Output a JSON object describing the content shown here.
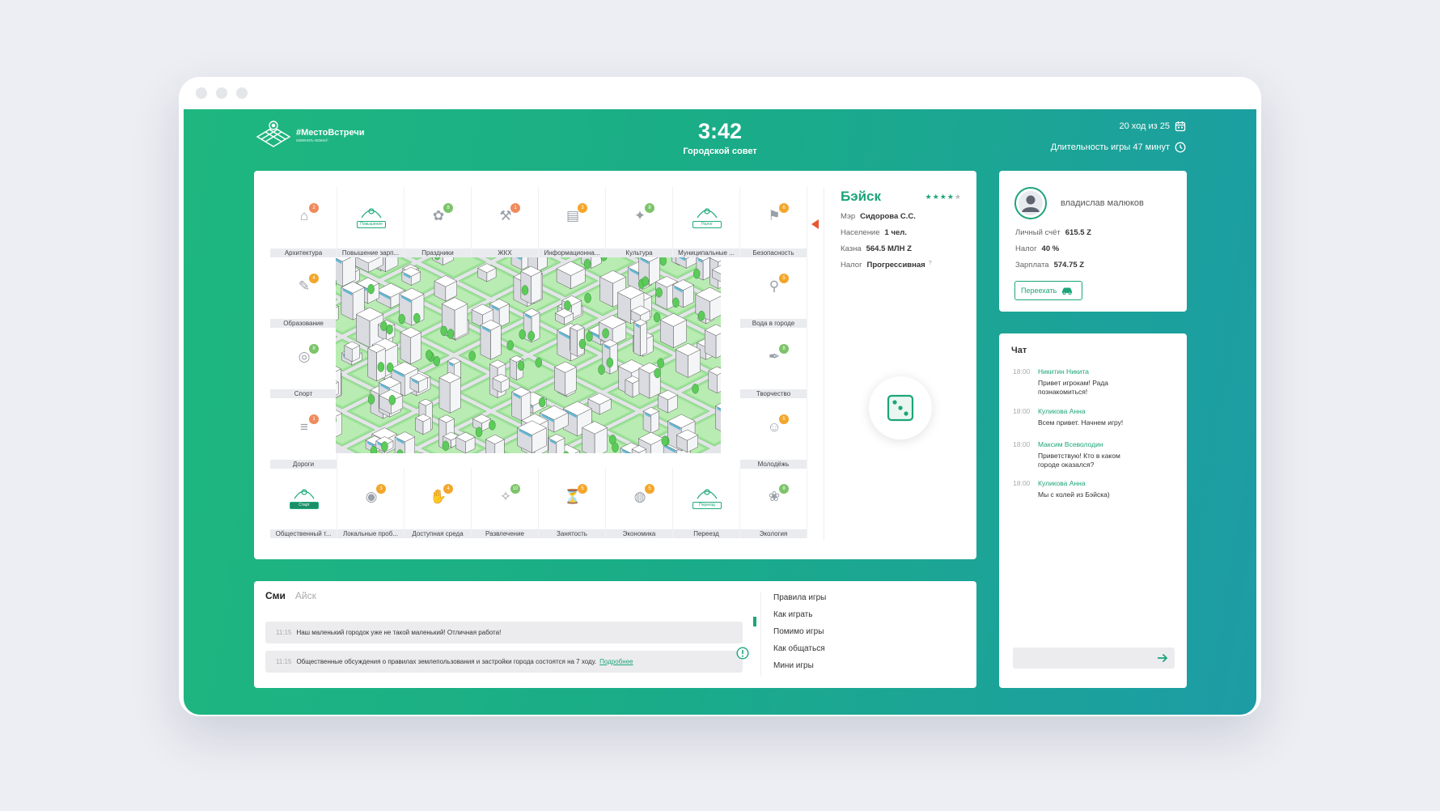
{
  "header": {
    "logo_title": "#МестоВстречи",
    "logo_subtitle": "изменить можно!",
    "timer": "3:42",
    "screen": "Городской совет",
    "turn": "20 ход из 25",
    "duration": "Длительность игры 47 минут"
  },
  "board": {
    "tiles": [
      {
        "label": "Архитектура",
        "badge": "2",
        "badge_color": "#f08a5d"
      },
      {
        "label": "Повышение зарп...",
        "plate": "Повышение"
      },
      {
        "label": "Праздники",
        "badge": "8",
        "badge_color": "#7cc46a"
      },
      {
        "label": "ЖКХ",
        "badge": "1",
        "badge_color": "#f08a5d"
      },
      {
        "label": "Информационна...",
        "badge": "3",
        "badge_color": "#f4a62a"
      },
      {
        "label": "Культура",
        "badge": "8",
        "badge_color": "#7cc46a"
      },
      {
        "label": "Муниципальные ...",
        "plate": "Налог"
      },
      {
        "label": "Безопасность",
        "badge": "6",
        "badge_color": "#f4a62a"
      },
      {
        "label": "Образование",
        "badge": "4",
        "badge_color": "#f4a62a"
      },
      {
        "label": "Вода в городе",
        "badge": "5",
        "badge_color": "#f4a62a"
      },
      {
        "label": "Спорт",
        "badge": "8",
        "badge_color": "#7cc46a"
      },
      {
        "label": "Творчество",
        "badge": "8",
        "badge_color": "#7cc46a"
      },
      {
        "label": "Дороги",
        "badge": "1",
        "badge_color": "#f08a5d"
      },
      {
        "label": "Молодёжь",
        "badge": "5",
        "badge_color": "#f4a62a"
      },
      {
        "label": "Общественный т...",
        "plate": "Старт",
        "plate_dark": true
      },
      {
        "label": "Локальные проб...",
        "badge": "3",
        "badge_color": "#f4a62a"
      },
      {
        "label": "Доступная среда",
        "badge": "4",
        "badge_color": "#f4a62a"
      },
      {
        "label": "Развлечение",
        "badge": "10",
        "badge_color": "#7cc46a"
      },
      {
        "label": "Занятость",
        "badge": "5",
        "badge_color": "#f4a62a"
      },
      {
        "label": "Экономика",
        "badge": "5",
        "badge_color": "#f4a62a"
      },
      {
        "label": "Переезд",
        "plate": "Переезд"
      },
      {
        "label": "Экология",
        "badge": "8",
        "badge_color": "#7cc46a"
      }
    ]
  },
  "city": {
    "name": "Бэйск",
    "rating": 4,
    "rating_max": 5,
    "mayor_label": "Мэр",
    "mayor": "Сидорова С.С.",
    "population_label": "Население",
    "population": "1 чел.",
    "treasury_label": "Казна",
    "treasury": "564.5 МЛН Z",
    "tax_label": "Налог",
    "tax": "Прогрессивная",
    "tax_hint": "?"
  },
  "news": {
    "tabs": [
      "Сми",
      "Айск"
    ],
    "items": [
      {
        "time": "11:15",
        "text": "Наш маленький городок уже не такой маленький! Отличная работа!"
      },
      {
        "time": "11:15",
        "text": "Общественные обсуждения о правилах землепользования и застройки города состоятся на 7 ходу.",
        "link": "Подробнее"
      }
    ],
    "links": [
      "Правила игры",
      "Как играть",
      "Помимо игры",
      "Как общаться",
      "Мини игры"
    ]
  },
  "player": {
    "name": "владислав малюков",
    "account_label": "Личный счёт",
    "account": "615.5 Z",
    "tax_label": "Налог",
    "tax": "40 %",
    "salary_label": "Зарплата",
    "salary": "574.75 Z",
    "move_button": "Переехать"
  },
  "chat": {
    "title": "Чат",
    "messages": [
      {
        "time": "18:00",
        "name": "Никитин Никита",
        "text": "Привет игрокам! Рада познакомиться!"
      },
      {
        "time": "18:00",
        "name": "Куликова Анна",
        "text": "Всем привет. Начнем игру!"
      },
      {
        "time": "18:00",
        "name": "Максим Всеволодин",
        "text": "Приветствую! Кто в каком городе оказался?"
      },
      {
        "time": "18:00",
        "name": "Куликова Анна",
        "text": "Мы с колей из Бэйска)"
      }
    ],
    "input_placeholder": ""
  },
  "colors": {
    "accent": "#1da57a",
    "gradient_start": "#1fb77f",
    "gradient_end": "#1d9ca5",
    "pointer": "#e9542f"
  }
}
